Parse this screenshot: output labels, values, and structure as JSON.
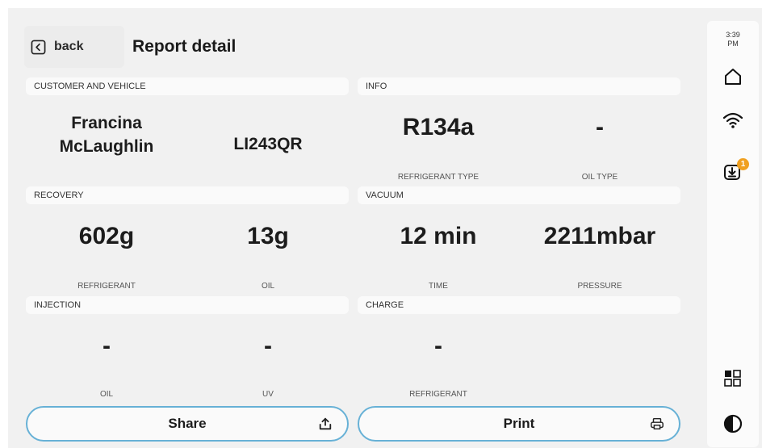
{
  "header": {
    "back_label": "back",
    "title": "Report detail"
  },
  "sections": {
    "customer": {
      "title": "CUSTOMER AND VEHICLE",
      "name_line1": "Francina",
      "name_line2": "McLaughlin",
      "plate": "LI243QR"
    },
    "info": {
      "title": "INFO",
      "refrigerant_type_value": "R134a",
      "refrigerant_type_label": "REFRIGERANT TYPE",
      "oil_type_value": "-",
      "oil_type_label": "OIL TYPE"
    },
    "recovery": {
      "title": "RECOVERY",
      "refrigerant_value": "602g",
      "refrigerant_label": "REFRIGERANT",
      "oil_value": "13g",
      "oil_label": "OIL"
    },
    "vacuum": {
      "title": "VACUUM",
      "time_value": "12 min",
      "time_label": "TIME",
      "pressure_value": "2211mbar",
      "pressure_label": "PRESSURE"
    },
    "injection": {
      "title": "INJECTION",
      "oil_value": "-",
      "oil_label": "OIL",
      "uv_value": "-",
      "uv_label": "UV"
    },
    "charge": {
      "title": "CHARGE",
      "refrigerant_value": "-",
      "refrigerant_label": "REFRIGERANT"
    }
  },
  "actions": {
    "share_label": "Share",
    "print_label": "Print"
  },
  "sidebar": {
    "time": "3:39",
    "ampm": "PM",
    "download_badge": "1",
    "icons": [
      "home-icon",
      "wifi-icon",
      "download-icon",
      "apps-grid-icon",
      "contrast-icon"
    ]
  },
  "colors": {
    "accent": "#67b1d6",
    "badge": "#f0a020",
    "background": "#f1f1f1"
  }
}
